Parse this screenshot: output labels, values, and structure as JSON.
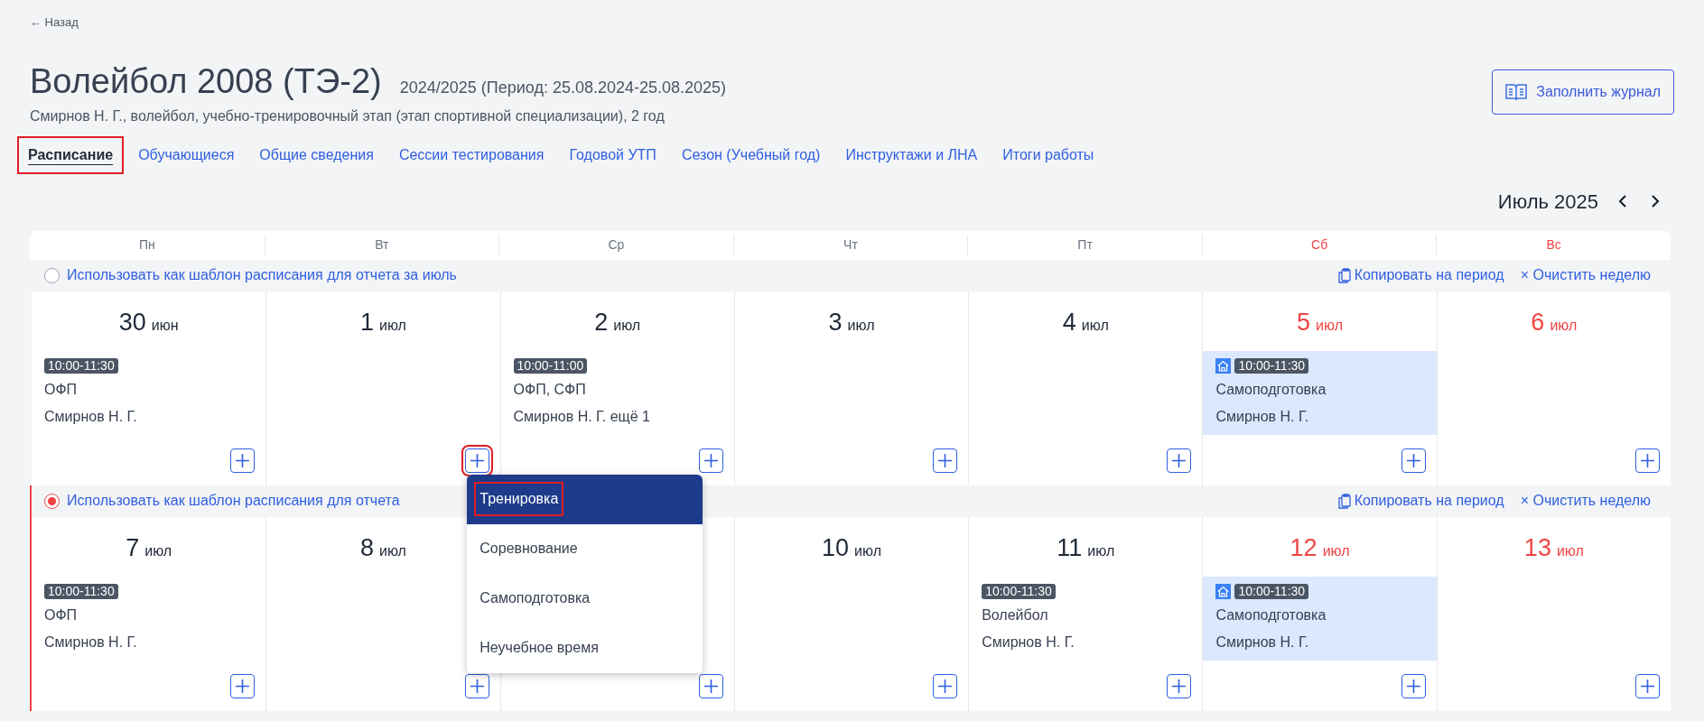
{
  "back_link": "← Назад",
  "title": "Волейбол 2008 (ТЭ-2)",
  "period": "2024/2025 (Период: 25.08.2024-25.08.2025)",
  "subtitle": "Смирнов Н. Г., волейбол, учебно-тренировочный этап (этап спортивной специализации), 2 год",
  "journal_button": "Заполнить журнал",
  "tabs": [
    {
      "label": "Расписание",
      "selected": true,
      "highlighted": true
    },
    {
      "label": "Обучающиеся",
      "selected": false,
      "highlighted": false
    },
    {
      "label": "Общие сведения",
      "selected": false,
      "highlighted": false
    },
    {
      "label": "Сессии тестирования",
      "selected": false,
      "highlighted": false
    },
    {
      "label": "Годовой УТП",
      "selected": false,
      "highlighted": false
    },
    {
      "label": "Сезон (Учебный год)",
      "selected": false,
      "highlighted": false
    },
    {
      "label": "Инструктажи и ЛНА",
      "selected": false,
      "highlighted": false
    },
    {
      "label": "Итоги работы",
      "selected": false,
      "highlighted": false
    }
  ],
  "month": "Июль 2025",
  "weekdays": [
    {
      "label": "Пн",
      "weekend": false
    },
    {
      "label": "Вт",
      "weekend": false
    },
    {
      "label": "Ср",
      "weekend": false
    },
    {
      "label": "Чт",
      "weekend": false
    },
    {
      "label": "Пт",
      "weekend": false
    },
    {
      "label": "Сб",
      "weekend": true
    },
    {
      "label": "Вс",
      "weekend": true
    }
  ],
  "weeks": [
    {
      "template_label": "Использовать как шаблон расписания для отчета за июль",
      "selected": false,
      "copy_label": "Копировать на период",
      "clear_label": "× Очистить неделю",
      "days": [
        {
          "day": "30",
          "month": "июн",
          "add_highlighted": false,
          "events": [
            {
              "kind": "training",
              "time": "10:00-11:30",
              "title": "ОФП",
              "person": "Смирнов Н. Г."
            }
          ]
        },
        {
          "day": "1",
          "month": "июл",
          "add_highlighted": true
        },
        {
          "day": "2",
          "month": "июл",
          "add_highlighted": false,
          "events": [
            {
              "kind": "training",
              "time": "10:00-11:00",
              "title": "ОФП, СФП",
              "person": "Смирнов Н. Г. ещё 1"
            }
          ]
        },
        {
          "day": "3",
          "month": "июл",
          "add_highlighted": false
        },
        {
          "day": "4",
          "month": "июл",
          "add_highlighted": false
        },
        {
          "day": "5",
          "month": "июл",
          "add_highlighted": false,
          "events": [
            {
              "kind": "self",
              "time": "10:00-11:30",
              "title": "Самоподготовка",
              "person": "Смирнов Н. Г."
            }
          ]
        },
        {
          "day": "6",
          "month": "июл",
          "add_highlighted": false
        }
      ]
    },
    {
      "template_label": "Использовать как шаблон расписания для отчета",
      "selected": true,
      "copy_label": "Копировать на период",
      "clear_label": "× Очистить неделю",
      "days": [
        {
          "day": "7",
          "month": "июл",
          "add_highlighted": false,
          "events": [
            {
              "kind": "training",
              "time": "10:00-11:30",
              "title": "ОФП",
              "person": "Смирнов Н. Г."
            }
          ]
        },
        {
          "day": "8",
          "month": "июл",
          "add_highlighted": false
        },
        {
          "add_highlighted": false
        },
        {
          "day": "10",
          "month": "июл",
          "add_highlighted": false
        },
        {
          "day": "11",
          "month": "июл",
          "add_highlighted": false,
          "events": [
            {
              "kind": "training",
              "time": "10:00-11:30",
              "title": "Волейбол",
              "person": "Смирнов Н. Г."
            }
          ]
        },
        {
          "day": "12",
          "month": "июл",
          "add_highlighted": false,
          "events": [
            {
              "kind": "self",
              "time": "10:00-11:30",
              "title": "Самоподготовка",
              "person": "Смирнов Н. Г."
            }
          ]
        },
        {
          "day": "13",
          "month": "июл",
          "add_highlighted": false
        }
      ]
    }
  ],
  "dropdown": {
    "items": [
      {
        "label": "Тренировка",
        "selected": true,
        "highlighted": true
      },
      {
        "label": "Соревнование",
        "selected": false,
        "highlighted": false
      },
      {
        "label": "Самоподготовка",
        "selected": false,
        "highlighted": false
      },
      {
        "label": "Неучебное время",
        "selected": false,
        "highlighted": false
      }
    ]
  }
}
